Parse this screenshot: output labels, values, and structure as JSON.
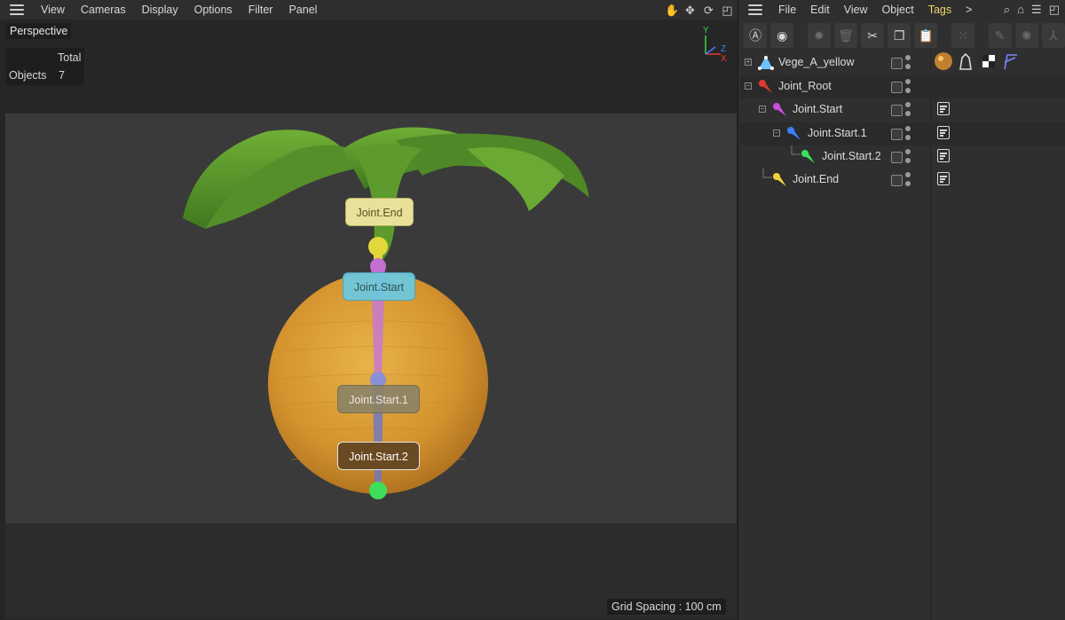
{
  "viewport": {
    "menu": [
      "View",
      "Cameras",
      "Display",
      "Options",
      "Filter",
      "Panel"
    ],
    "camera_label": "Perspective",
    "stats": {
      "header": "Total",
      "row_label": "Objects",
      "row_value": "7"
    },
    "grid_spacing": "Grid Spacing : 100 cm",
    "axis": {
      "y": "Y",
      "z": "Z",
      "x": "X"
    },
    "joint_labels": {
      "end": "Joint.End",
      "start": "Joint.Start",
      "start1": "Joint.Start.1",
      "start2": "Joint.Start.2"
    },
    "tool_icons": [
      "hand-icon",
      "move-icon",
      "rotate-icon",
      "maximize-icon"
    ]
  },
  "object_manager": {
    "menu": [
      "File",
      "Edit",
      "View",
      "Object",
      "Tags"
    ],
    "active_menu": "Tags",
    "more": ">",
    "objects": [
      {
        "name": "Vege_A_yellow",
        "icon_color": "#6ec3ff"
      },
      {
        "name": "Joint_Root",
        "icon_color": "#e0392b"
      },
      {
        "name": "Joint.Start",
        "icon_color": "#c84fe0"
      },
      {
        "name": "Joint.Start.1",
        "icon_color": "#3d7fff"
      },
      {
        "name": "Joint.Start.2",
        "icon_color": "#3ddf5a"
      },
      {
        "name": "Joint.End",
        "icon_color": "#f0d23a"
      }
    ]
  },
  "colors": {
    "accent_menu": "#f0d46a",
    "fruit": "#d89a32",
    "leaves": "#5f9f2e"
  }
}
